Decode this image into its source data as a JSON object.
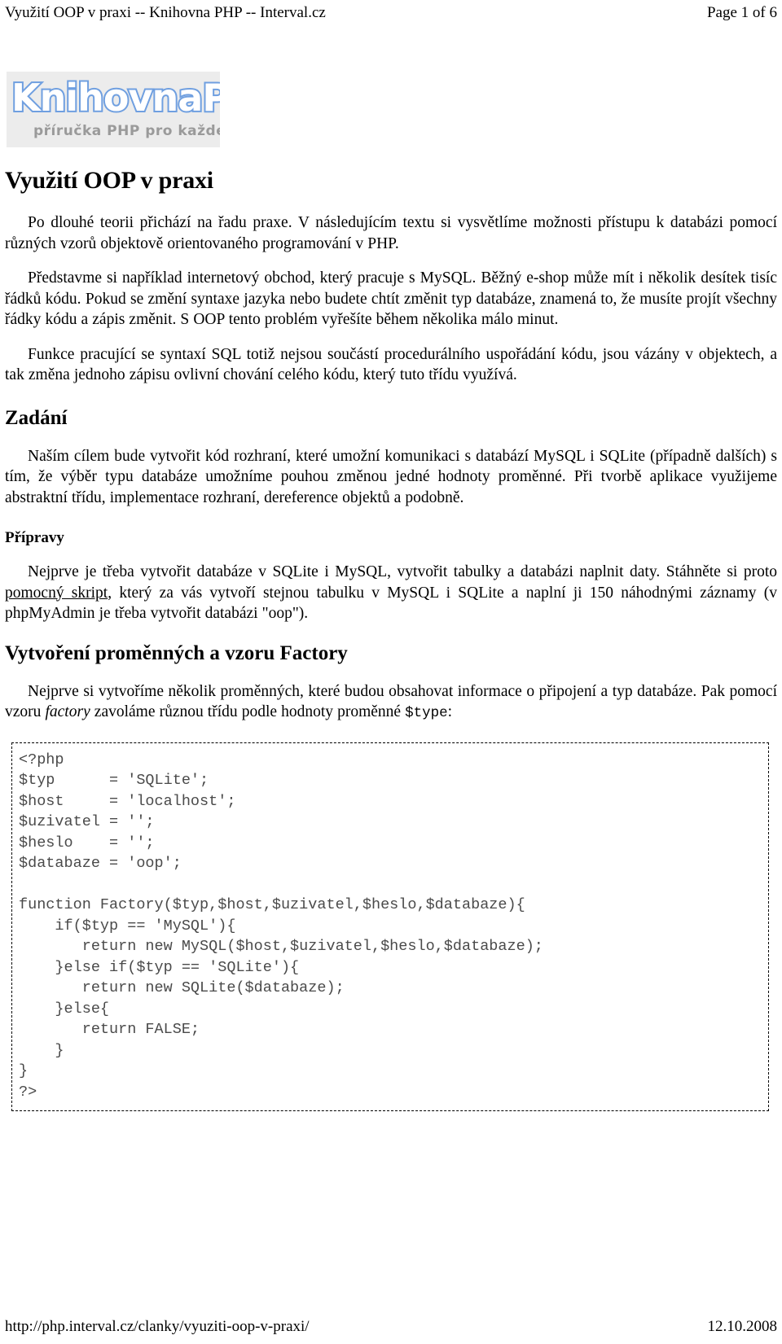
{
  "header": {
    "title": "Využití OOP v praxi -- Knihovna PHP -- Interval.cz",
    "page_indicator": "Page 1 of 6"
  },
  "logo": {
    "wordmark": "KnihovnaPHP",
    "tagline": "příručka PHP pro každého",
    "outline_color": "#6f9fe0",
    "fill_color": "#ffffff",
    "tagline_color": "#9a9a9a",
    "background_color": "#ececec"
  },
  "article": {
    "title": "Využití OOP v praxi",
    "intro_paragraph_1": "Po dlouhé teorii přichází na řadu praxe. V následujícím textu si vysvětlíme možnosti přístupu k databázi pomocí různých vzorů objektově orientovaného programování v PHP.",
    "intro_paragraph_2": "Představme si například internetový obchod, který pracuje s MySQL. Běžný e-shop může mít i několik desítek tisíc řádků kódu. Pokud se změní syntaxe jazyka nebo budete chtít změnit typ databáze, znamená to, že musíte projít všechny řádky kódu a zápis změnit. S OOP tento problém vyřešíte během několika málo minut.",
    "intro_paragraph_3": "Funkce pracující se syntaxí SQL totiž nejsou součástí procedurálního uspořádání kódu, jsou vázány v objektech, a tak změna jednoho zápisu ovlivní chování celého kódu, který tuto třídu využívá.",
    "section_zadani": {
      "heading": "Zadání",
      "paragraph": "Naším cílem bude vytvořit kód rozhraní, které umožní komunikaci s databází MySQL i SQLite (případně dalších) s tím, že výběr typu databáze umožníme pouhou změnou jedné hodnoty proměnné. Při tvorbě aplikace využijeme abstraktní třídu, implementace rozhraní, dereference objektů a podobně."
    },
    "section_pripravy": {
      "heading": "Přípravy",
      "paragraph_before_link": "Nejprve je třeba vytvořit databáze v SQLite i MySQL, vytvořit tabulky a databázi naplnit daty. Stáhněte si proto ",
      "link_text": "pomocný skript",
      "paragraph_after_link": ", který za vás vytvoří stejnou tabulku v MySQL i SQLite a naplní ji 150 náhodnými záznamy (v phpMyAdmin je třeba vytvořit databázi \"oop\")."
    },
    "section_factory": {
      "heading": "Vytvoření proměnných a vzoru Factory",
      "paragraph_part_1": "Nejprve si vytvoříme několik proměnných, které budou obsahovat informace o připojení a typ databáze. Pak pomocí vzoru ",
      "paragraph_italic": "factory",
      "paragraph_part_2": " zavoláme různou třídu podle hodnoty proměnné ",
      "paragraph_code": "$type",
      "paragraph_part_3": ":"
    },
    "code_sample": "<?php\n$typ      = 'SQLite';\n$host     = 'localhost';\n$uzivatel = '';\n$heslo    = '';\n$databaze = 'oop';\n\nfunction Factory($typ,$host,$uzivatel,$heslo,$databaze){\n    if($typ == 'MySQL'){\n       return new MySQL($host,$uzivatel,$heslo,$databaze);\n    }else if($typ == 'SQLite'){\n       return new SQLite($databaze);\n    }else{\n       return FALSE;\n    }\n}\n?>"
  },
  "footer": {
    "url": "http://php.interval.cz/clanky/vyuziti-oop-v-praxi/",
    "date": "12.10.2008"
  }
}
